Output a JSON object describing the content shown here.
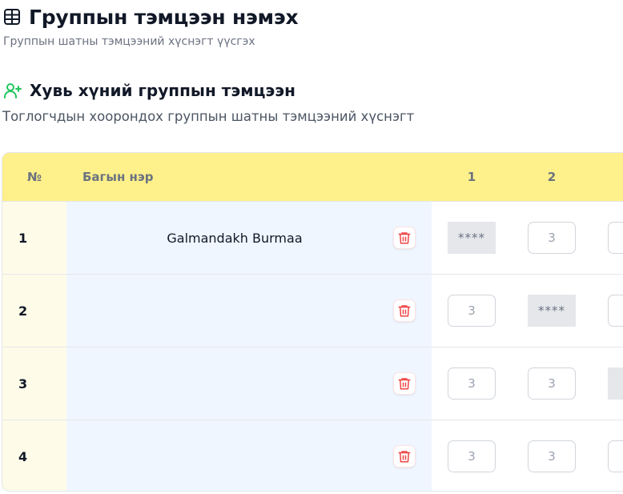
{
  "page": {
    "title": "Группын тэмцээн нэмэх",
    "subtitle": "Группын шатны тэмцээний хүснэгт үүсгэх"
  },
  "section": {
    "title": "Хувь хүний группын тэмцээн",
    "subtitle": "Тоглогчдын хоорондох группын шатны тэмцээний хүснэгт"
  },
  "table": {
    "headers": {
      "no": "№",
      "name": "Багын нэр",
      "cols": [
        "1",
        "2"
      ]
    },
    "rows": [
      {
        "no": "1",
        "name": "Galmandakh Burmaa",
        "scores": [
          "****",
          "3",
          ""
        ]
      },
      {
        "no": "2",
        "name": "",
        "scores": [
          "3",
          "****",
          ""
        ]
      },
      {
        "no": "3",
        "name": "",
        "scores": [
          "3",
          "3",
          "*"
        ]
      },
      {
        "no": "4",
        "name": "",
        "scores": [
          "3",
          "3",
          ""
        ]
      }
    ]
  },
  "colors": {
    "header_bg": "#fef08a",
    "no_col_bg": "#fefce8",
    "name_col_bg": "#eff6ff",
    "delete_red": "#ef4444",
    "icon_green": "#22c55e"
  }
}
